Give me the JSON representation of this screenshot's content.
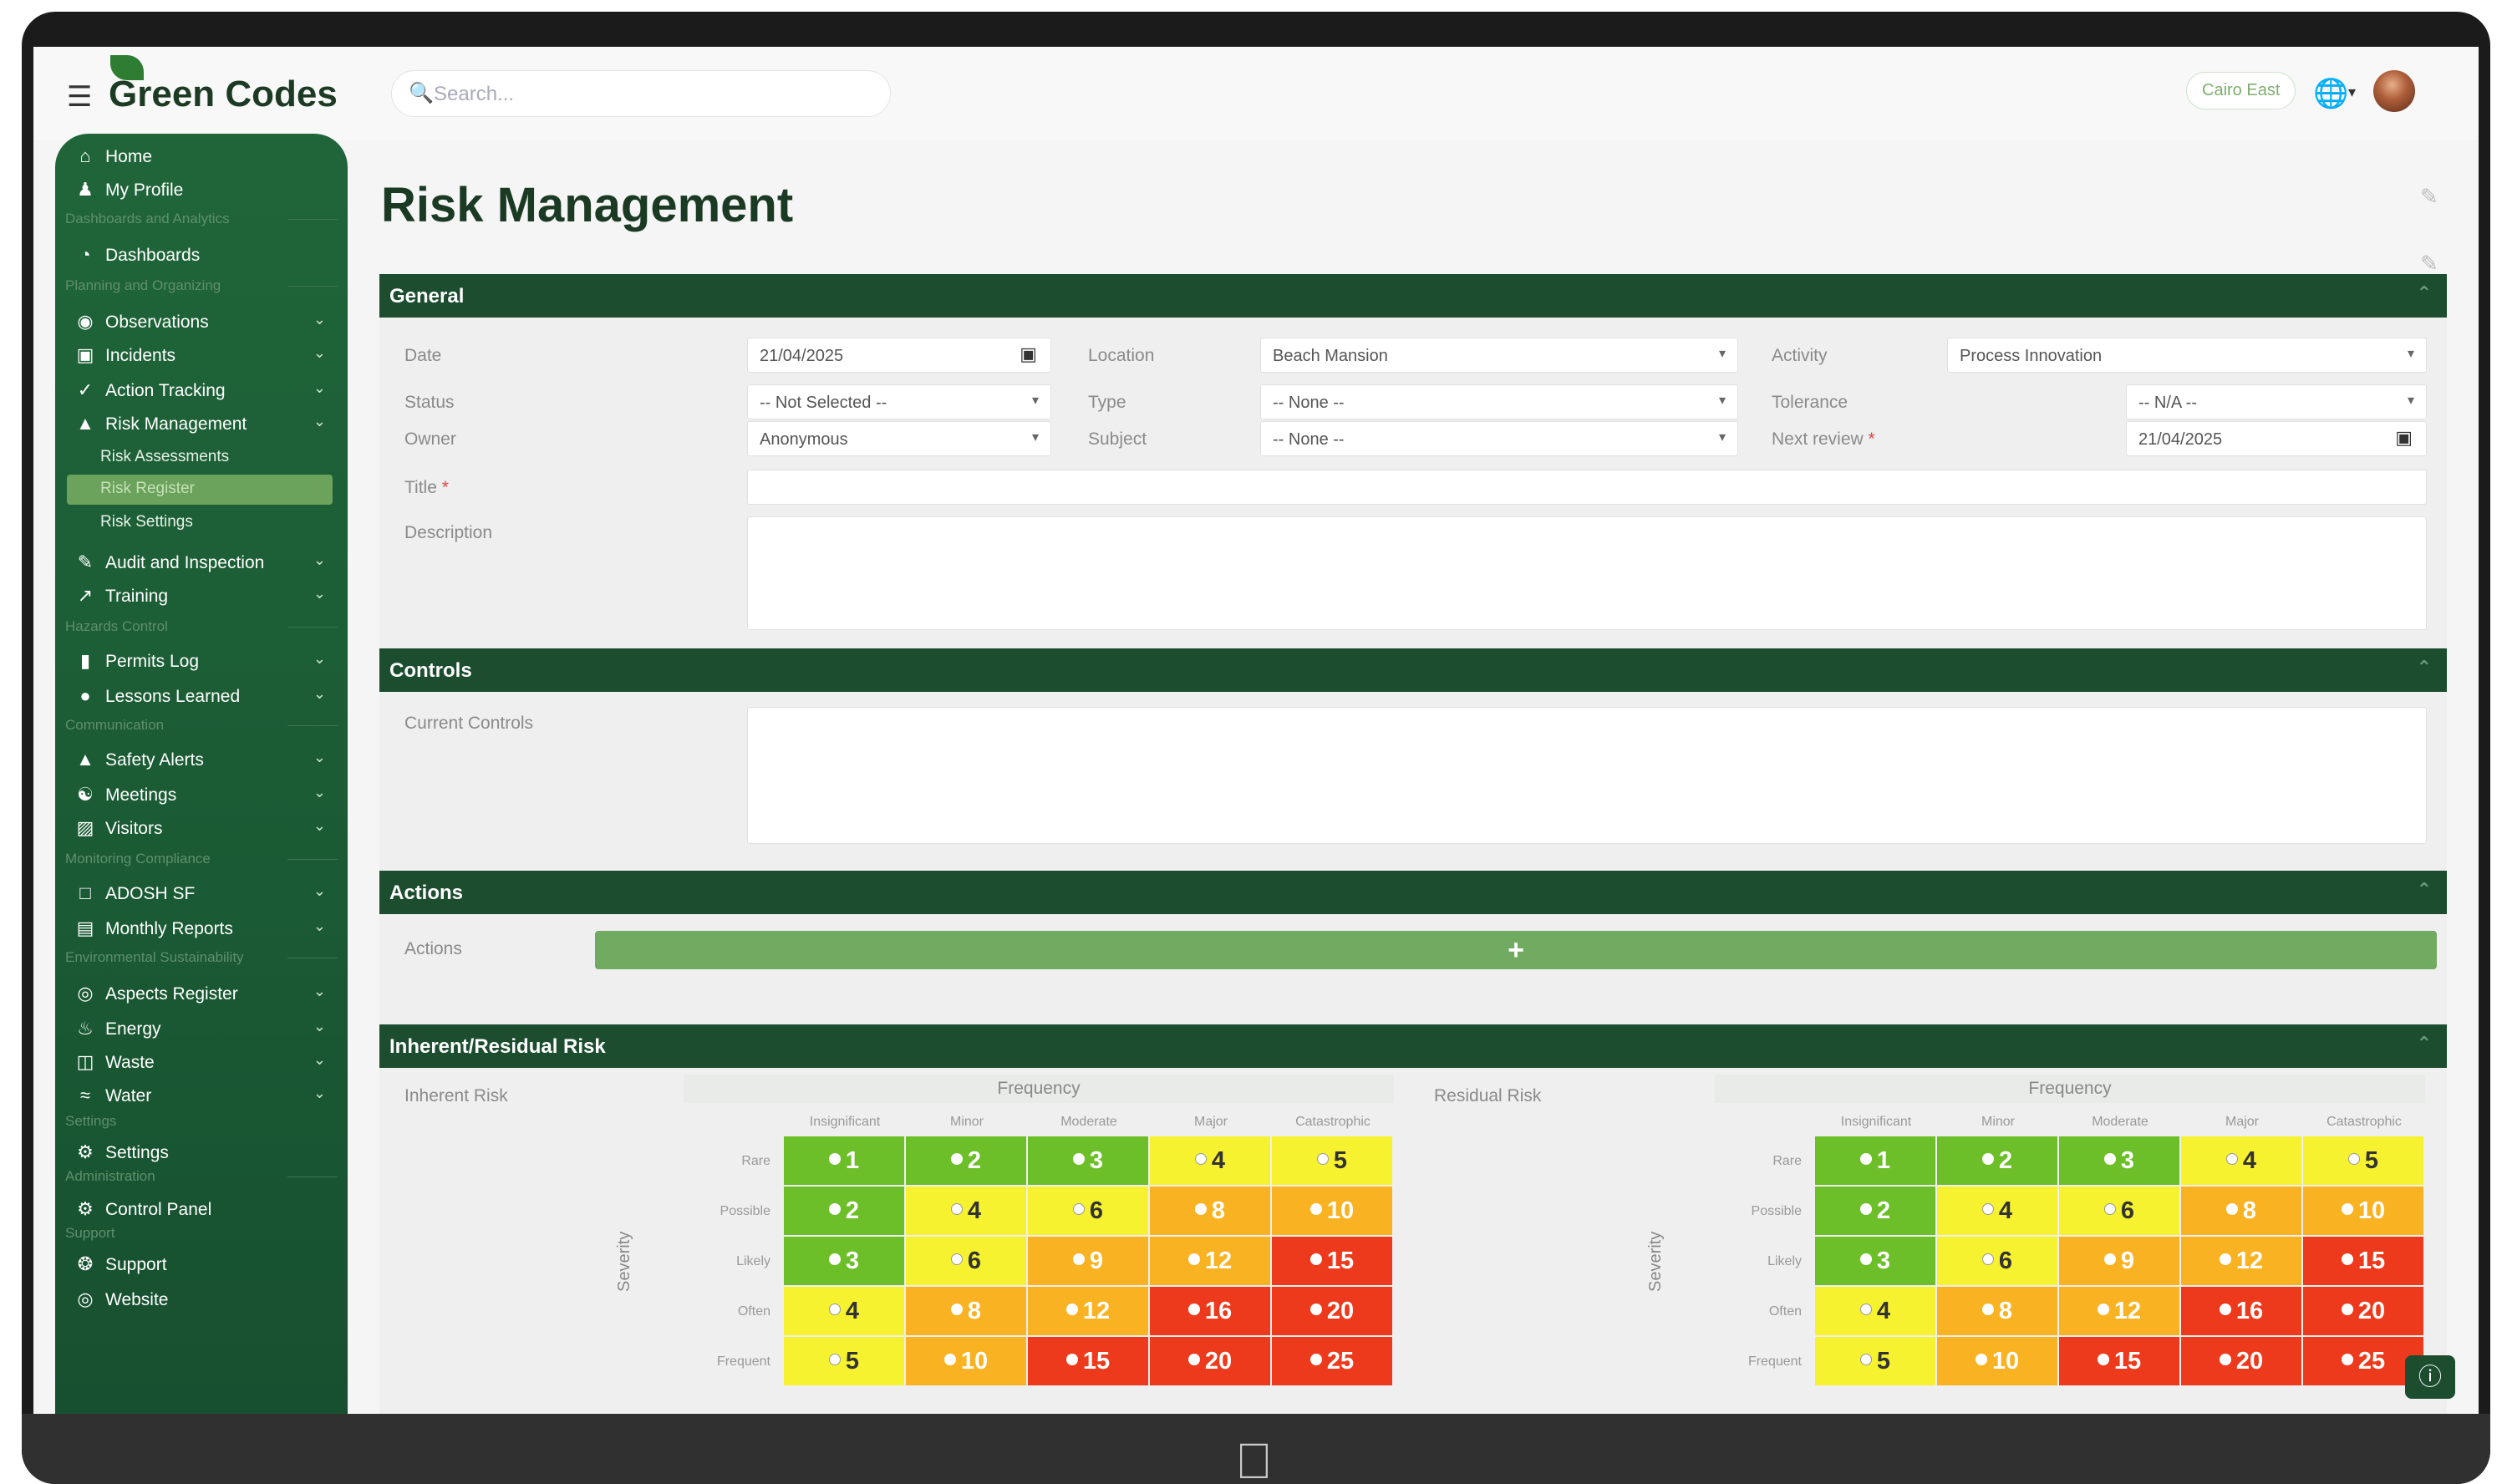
{
  "app": {
    "logo_text": "Green Codes",
    "search_placeholder": "Search...",
    "location_badge": "Cairo East"
  },
  "sidebar": {
    "home": "Home",
    "my_profile": "My Profile",
    "sec_dashboards": "Dashboards and Analytics",
    "dashboards": "Dashboards",
    "sec_planning": "Planning and Organizing",
    "observations": "Observations",
    "incidents": "Incidents",
    "action_tracking": "Action Tracking",
    "risk_management": "Risk Management",
    "risk_assessments": "Risk Assessments",
    "risk_register": "Risk Register",
    "risk_settings": "Risk Settings",
    "audit": "Audit and Inspection",
    "training": "Training",
    "sec_hazards": "Hazards Control",
    "permits": "Permits Log",
    "lessons": "Lessons Learned",
    "sec_comm": "Communication",
    "safety_alerts": "Safety Alerts",
    "meetings": "Meetings",
    "visitors": "Visitors",
    "sec_monitor": "Monitoring Compliance",
    "adosh": "ADOSH SF",
    "monthly_reports": "Monthly Reports",
    "sec_env": "Environmental Sustainability",
    "aspects": "Aspects Register",
    "energy": "Energy",
    "waste": "Waste",
    "water": "Water",
    "sec_settings": "Settings",
    "settings": "Settings",
    "sec_admin": "Administration",
    "control_panel": "Control Panel",
    "sec_support": "Support",
    "support": "Support",
    "website": "Website"
  },
  "page": {
    "title": "Risk Management"
  },
  "general": {
    "header": "General",
    "date_label": "Date",
    "date_value": "21/04/2025",
    "location_label": "Location",
    "location_value": "Beach Mansion",
    "activity_label": "Activity",
    "activity_value": "Process Innovation",
    "status_label": "Status",
    "status_value": "-- Not Selected --",
    "type_label": "Type",
    "type_value": "-- None --",
    "tolerance_label": "Tolerance",
    "tolerance_value": "-- N/A --",
    "owner_label": "Owner",
    "owner_value": "Anonymous",
    "subject_label": "Subject",
    "subject_value": "-- None --",
    "next_review_label": "Next review",
    "next_review_value": "21/04/2025",
    "title_label": "Title",
    "description_label": "Description",
    "required_mark": "*"
  },
  "controls": {
    "header": "Controls",
    "current_controls_label": "Current Controls"
  },
  "actions": {
    "header": "Actions",
    "actions_label": "Actions",
    "add_label": "+"
  },
  "risk": {
    "header": "Inherent/Residual Risk",
    "inherent_label": "Inherent Risk",
    "residual_label": "Residual Risk",
    "frequency_label": "Frequency",
    "severity_label": "Severity",
    "columns": [
      "Insignificant",
      "Minor",
      "Moderate",
      "Major",
      "Catastrophic"
    ],
    "rows": [
      "Rare",
      "Possible",
      "Likely",
      "Often",
      "Frequent"
    ],
    "values": [
      [
        1,
        2,
        3,
        4,
        5
      ],
      [
        2,
        4,
        6,
        8,
        10
      ],
      [
        3,
        6,
        9,
        12,
        15
      ],
      [
        4,
        8,
        12,
        16,
        20
      ],
      [
        5,
        10,
        15,
        20,
        25
      ]
    ],
    "colors": [
      [
        "green",
        "green",
        "green",
        "yellow",
        "yellow"
      ],
      [
        "green",
        "yellow",
        "yellow",
        "orange",
        "orange"
      ],
      [
        "green",
        "yellow",
        "orange",
        "orange",
        "red"
      ],
      [
        "yellow",
        "orange",
        "orange",
        "red",
        "red"
      ],
      [
        "yellow",
        "orange",
        "red",
        "red",
        "red"
      ]
    ],
    "palette": {
      "green": "#6dbf29",
      "yellow": "#f7f22f",
      "orange": "#f9b221",
      "red": "#ee3a1c"
    }
  },
  "theme": {
    "brand_dark": "#1c4d2f",
    "sidebar_green": "#1a5a34",
    "accent_green": "#71aa61"
  }
}
